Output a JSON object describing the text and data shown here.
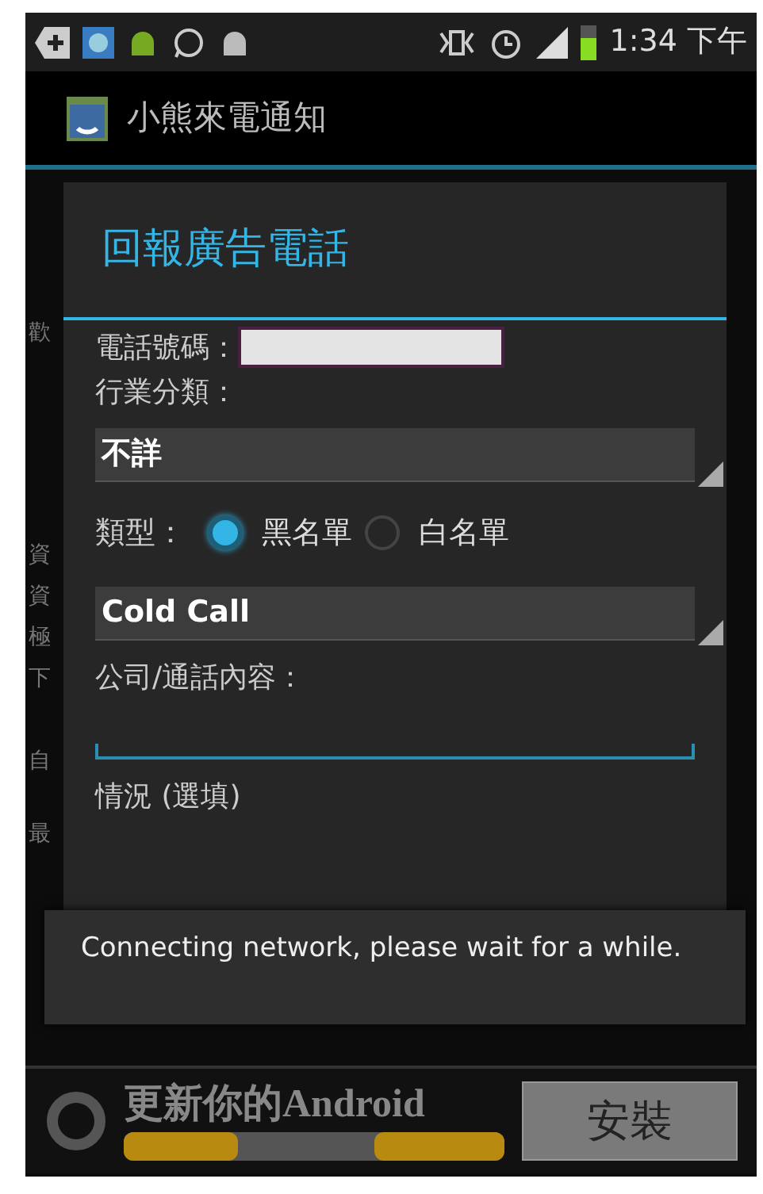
{
  "status_bar": {
    "time": "1:34 下午"
  },
  "app_bar": {
    "title": "小熊來電通知"
  },
  "background_fragments": [
    "歡",
    "資",
    "資",
    "極",
    "下",
    "自",
    "最"
  ],
  "dialog": {
    "title": "回報廣告電話",
    "phone_label": "電話號碼：",
    "industry_label": "行業分類：",
    "industry_value": "不詳",
    "type_label": "類型：",
    "type_options": [
      {
        "label": "黑名單",
        "selected": true
      },
      {
        "label": "白名單",
        "selected": false
      }
    ],
    "category_value": "Cold Call",
    "content_label": "公司/通話內容：",
    "status_label": "情況 (選填)"
  },
  "toast": "Connecting network, please wait for a while.",
  "ad": {
    "text": "更新你的Android",
    "button": "安裝"
  }
}
